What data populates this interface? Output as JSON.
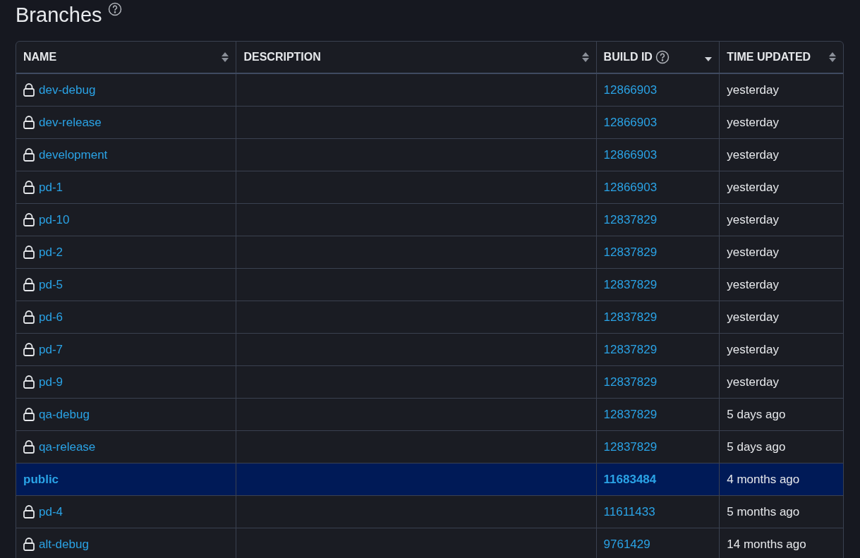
{
  "title": "Branches",
  "columns": [
    {
      "label": "NAME",
      "sorted": false,
      "help": false
    },
    {
      "label": "DESCRIPTION",
      "sorted": false,
      "help": false
    },
    {
      "label": "BUILD ID",
      "sorted": true,
      "help": true
    },
    {
      "label": "TIME UPDATED",
      "sorted": false,
      "help": false
    }
  ],
  "rows": [
    {
      "name": "dev-debug",
      "locked": true,
      "selected": false,
      "build_id": "12866903",
      "time": "yesterday"
    },
    {
      "name": "dev-release",
      "locked": true,
      "selected": false,
      "build_id": "12866903",
      "time": "yesterday"
    },
    {
      "name": "development",
      "locked": true,
      "selected": false,
      "build_id": "12866903",
      "time": "yesterday"
    },
    {
      "name": "pd-1",
      "locked": true,
      "selected": false,
      "build_id": "12866903",
      "time": "yesterday"
    },
    {
      "name": "pd-10",
      "locked": true,
      "selected": false,
      "build_id": "12837829",
      "time": "yesterday"
    },
    {
      "name": "pd-2",
      "locked": true,
      "selected": false,
      "build_id": "12837829",
      "time": "yesterday"
    },
    {
      "name": "pd-5",
      "locked": true,
      "selected": false,
      "build_id": "12837829",
      "time": "yesterday"
    },
    {
      "name": "pd-6",
      "locked": true,
      "selected": false,
      "build_id": "12837829",
      "time": "yesterday"
    },
    {
      "name": "pd-7",
      "locked": true,
      "selected": false,
      "build_id": "12837829",
      "time": "yesterday"
    },
    {
      "name": "pd-9",
      "locked": true,
      "selected": false,
      "build_id": "12837829",
      "time": "yesterday"
    },
    {
      "name": "qa-debug",
      "locked": true,
      "selected": false,
      "build_id": "12837829",
      "time": "5 days ago"
    },
    {
      "name": "qa-release",
      "locked": true,
      "selected": false,
      "build_id": "12837829",
      "time": "5 days ago"
    },
    {
      "name": "public",
      "locked": false,
      "selected": true,
      "build_id": "11683484",
      "time": "4 months ago"
    },
    {
      "name": "pd-4",
      "locked": true,
      "selected": false,
      "build_id": "11611433",
      "time": "5 months ago"
    },
    {
      "name": "alt-debug",
      "locked": true,
      "selected": false,
      "build_id": "9761429",
      "time": "14 months ago"
    }
  ]
}
